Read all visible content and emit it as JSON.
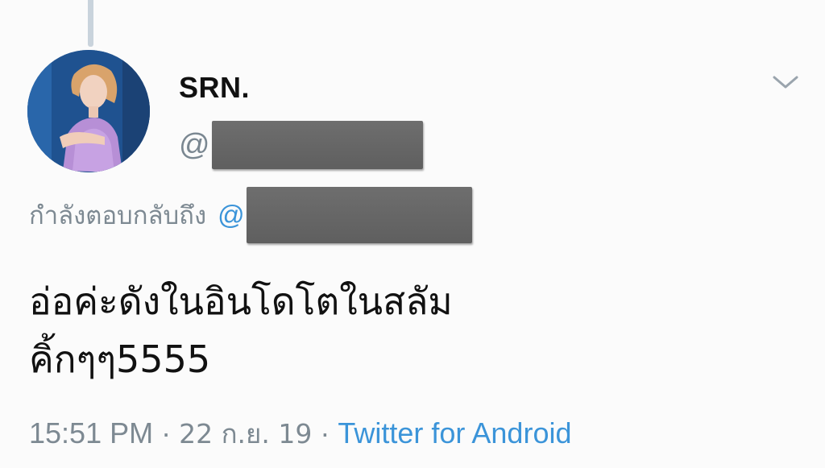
{
  "author": {
    "display_name": "SRN.",
    "handle_prefix": "@",
    "avatar_icon": "profile-photo"
  },
  "reply": {
    "prefix": "กำลังตอบกลับถึง",
    "at": "@"
  },
  "tweet": {
    "lines": [
      "อ่อค่ะดังในอินโดโตในสลัม",
      "คิ้กๆๆ5555"
    ]
  },
  "meta": {
    "time": "15:51 PM",
    "separator": "·",
    "date": "22 ก.ย. 19",
    "source": "Twitter for Android"
  },
  "colors": {
    "link": "#3b94d9",
    "muted": "#7d8992",
    "redaction": "#666666"
  }
}
